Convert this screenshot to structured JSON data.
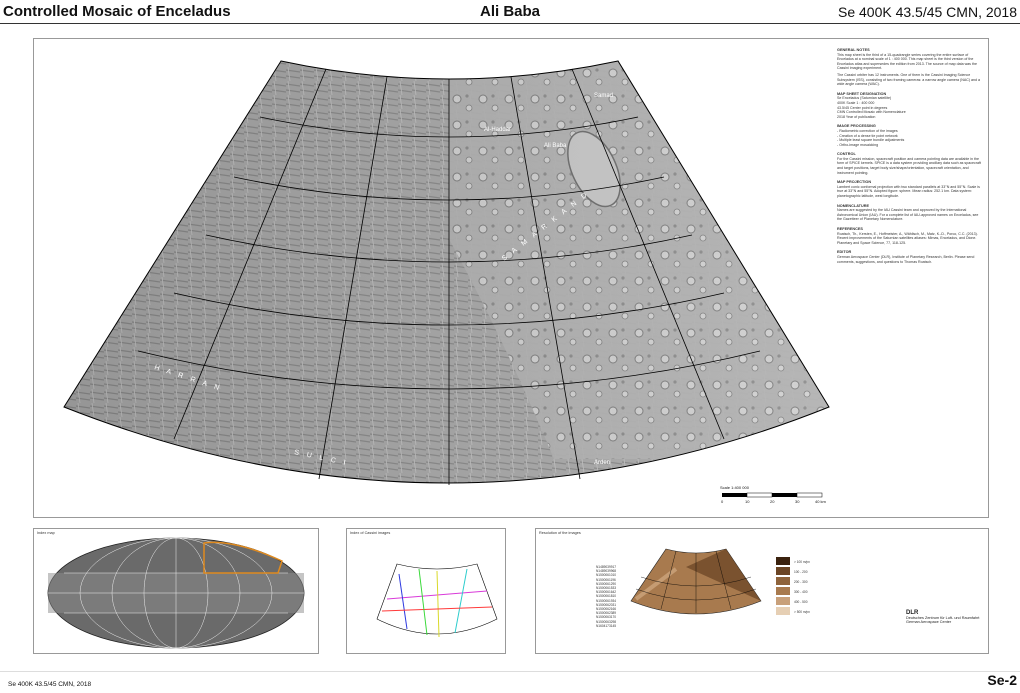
{
  "header": {
    "left_title": "Controlled Mosaic of Enceladus",
    "center_title": "Ali Baba",
    "right_title": "Se 400K 43.5/45 CMN, 2018"
  },
  "map": {
    "features": [
      "Samad",
      "Al-Haddar",
      "Ali Baba",
      "Aladdin",
      "Hassan",
      "Morgiana",
      "Ahmad",
      "Musa",
      "Faiyan",
      "Dunyazad",
      "Daleel",
      "Arden",
      "Peri-Banu",
      "Sarandib Planitia",
      "Harran Sulci",
      "Samarkand Sulci"
    ],
    "label_a": "S A M A R K A N D",
    "label_b": "H A R R A N",
    "label_c": "S U L C I"
  },
  "scale": {
    "title": "Scale 1:400 000",
    "ticks": [
      "0",
      "10",
      "20",
      "30",
      "40 km"
    ]
  },
  "notes": {
    "general_h": "GENERAL NOTES",
    "general_p1": "This map sheet is the third of a 15-quadrangle series covering the entire surface of Enceladus at a nominal scale of 1 : 400 000. This map sheet is the third version of the Enceladus atlas and supersedes the edition from 2013. The source of map data was the Cassini imaging experiment.",
    "general_p2": "The Cassini orbiter has 12 instruments. One of them is the Cassini Imaging Science Subsystem (ISS), consisting of two framing cameras: a narrow angle camera (NAC) and a wide angle camera (WAC).",
    "designation_h": "MAP SHEET DESIGNATION",
    "des_items": [
      "Se          Enceladus (Saturnian satellite)",
      "400K        Scale 1 : 400 000",
      "43.5/45     Center point in degrees",
      "CMN         Controlled Mosaic with Nomenclature",
      "2018        Year of publication"
    ],
    "processing_h": "IMAGE PROCESSING",
    "proc_items": [
      "- Radiometric correction of the images",
      "- Creation of a dense tie point network",
      "- Multiple least square bundle adjustments",
      "- Ortho-image mosaicking"
    ],
    "control_h": "CONTROL",
    "control_p": "For the Cassini mission, spacecraft position and camera pointing data are available in the form of SPICE kernels. SPICE is a data system providing ancillary data such as spacecraft and target positions, target body size/shape/orientation, spacecraft orientation, and instrument pointing.",
    "projection_h": "MAP PROJECTION",
    "projection_p": "Lambert conic conformal projection with two standard parallels at 33°N and 55°N. Scale is true at 33°N and 55°N. Adopted figure: sphere. Mean radius: 252.1 km. Data system: planetographic latitude, west longitude.",
    "nomenclature_h": "NOMENCLATURE",
    "nomenclature_p": "Names are suggested by the IAU Cassini team and approved by the International Astronomical Union (IAU). For a complete list of IAU-approved names on Enceladus, see the Gazetteer of Planetary Nomenclature.",
    "references_h": "REFERENCES",
    "references_p": "Roatsch, Th., Kersten, E., Hoffmeister, A., Wählisch, M., Matz, K.-D., Porco, C.C. (2013). Recent improvements of the Saturnian satellites atlases: Mimas, Enceladus, and Dione. Planetary and Space Science, 77, 118-125.",
    "editor_h": "EDITOR",
    "editor_p": "German Aerospace Center (DLR), Institute of Planetary Research, Berlin. Please send comments, suggestions, and questions to Thomas Roatsch."
  },
  "panels": {
    "index_title": "Index map",
    "images_title": "Index of Cassini images",
    "resolution_title": "Resolution of the images",
    "image_ids": [
      "N1489039917",
      "N1489039968",
      "N1500061010",
      "N1500061196",
      "N1500061290",
      "N1500061533",
      "N1500061642",
      "N1500061810",
      "N1500061934",
      "N1500062031",
      "N1500062166",
      "N1500062389",
      "N1500063170",
      "N1500063298",
      "N1604173145"
    ],
    "res_labels": [
      "> 100 m/px",
      "100 - 200",
      "200 - 300",
      "300 - 400",
      "400 - 500",
      "> 500 m/px"
    ],
    "dlr_name": "Deutsches Zentrum für Luft- und Raumfahrt",
    "dlr_sub": "German Aerospace Center",
    "dlr_logo": "DLR"
  },
  "footer": {
    "left": "Se 400K 43.5/45 CMN, 2018",
    "right": "Se-2"
  },
  "colors": {
    "map_dark": "#6e6e6e",
    "map_light": "#c9c9c9",
    "grid": "#000000",
    "highlight": "#e08a1e",
    "sepia": "#a87a4e"
  }
}
